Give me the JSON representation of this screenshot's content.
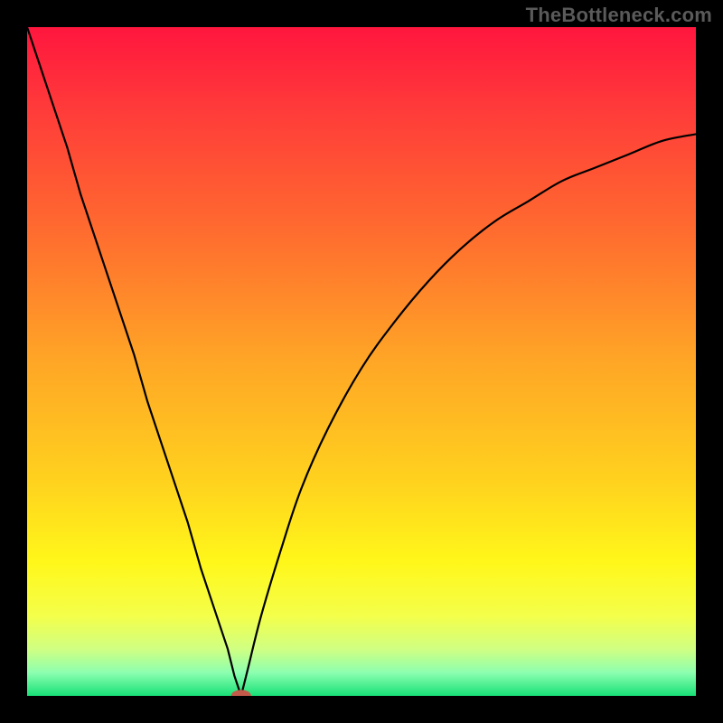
{
  "watermark": "TheBottleneck.com",
  "chart_data": {
    "type": "line",
    "title": "",
    "xlabel": "",
    "ylabel": "",
    "xlim": [
      0,
      100
    ],
    "ylim": [
      0,
      100
    ],
    "grid": false,
    "legend": false,
    "background_gradient": {
      "stops": [
        {
          "offset": 0.0,
          "color": "#ff163e"
        },
        {
          "offset": 0.12,
          "color": "#ff3a3a"
        },
        {
          "offset": 0.3,
          "color": "#ff6a2f"
        },
        {
          "offset": 0.5,
          "color": "#ffa626"
        },
        {
          "offset": 0.68,
          "color": "#ffd21e"
        },
        {
          "offset": 0.8,
          "color": "#fff71a"
        },
        {
          "offset": 0.88,
          "color": "#f4ff4a"
        },
        {
          "offset": 0.93,
          "color": "#d0ff82"
        },
        {
          "offset": 0.965,
          "color": "#8dffb0"
        },
        {
          "offset": 1.0,
          "color": "#18e077"
        }
      ]
    },
    "series": [
      {
        "name": "left-branch",
        "x": [
          0,
          2,
          4,
          6,
          8,
          10,
          12,
          14,
          16,
          18,
          20,
          22,
          24,
          26,
          28,
          30,
          31,
          32
        ],
        "values": [
          100,
          94,
          88,
          82,
          75,
          69,
          63,
          57,
          51,
          44,
          38,
          32,
          26,
          19,
          13,
          7,
          3,
          0
        ]
      },
      {
        "name": "right-branch",
        "x": [
          32,
          33,
          35,
          38,
          41,
          45,
          50,
          55,
          60,
          65,
          70,
          75,
          80,
          85,
          90,
          95,
          100
        ],
        "values": [
          0,
          4,
          12,
          22,
          31,
          40,
          49,
          56,
          62,
          67,
          71,
          74,
          77,
          79,
          81,
          83,
          84
        ]
      }
    ],
    "marker": {
      "name": "red-dot",
      "x": 32,
      "y": 0,
      "color": "#c45a4a",
      "rx": 1.5,
      "ry": 0.9
    }
  }
}
